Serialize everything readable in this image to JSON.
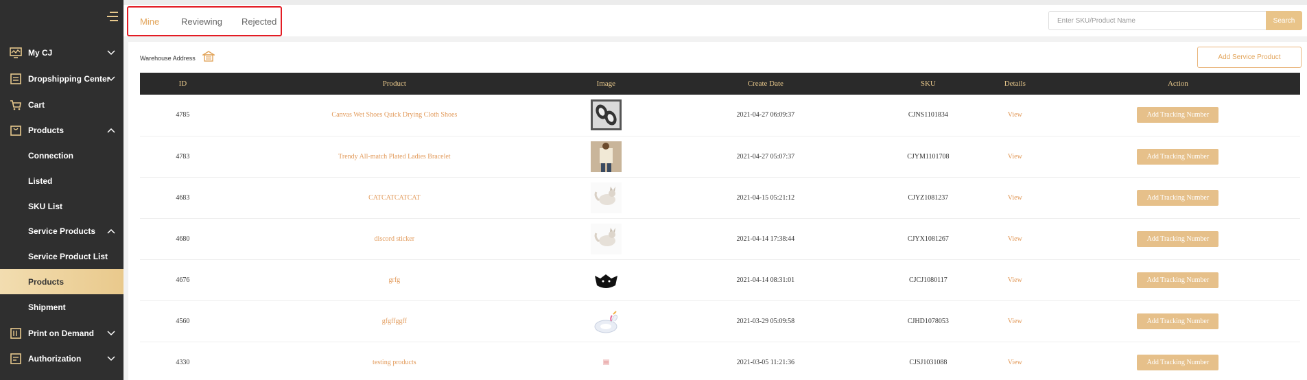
{
  "sidebar": {
    "items": [
      {
        "label": "My CJ",
        "icon": "monitor-icon",
        "chevron": "down"
      },
      {
        "label": "Dropshipping Center",
        "icon": "clipboard-icon",
        "chevron": "down"
      },
      {
        "label": "Cart",
        "icon": "cart-icon",
        "chevron": ""
      },
      {
        "label": "Products",
        "icon": "bag-icon",
        "chevron": "up"
      },
      {
        "label": "Connection"
      },
      {
        "label": "Listed"
      },
      {
        "label": "SKU List"
      },
      {
        "label": "Service Products",
        "chevron": "up"
      },
      {
        "label": "Service Product List"
      },
      {
        "label": "Products",
        "active": true
      },
      {
        "label": "Shipment"
      },
      {
        "label": "Print on Demand",
        "icon": "print-icon",
        "chevron": "down"
      },
      {
        "label": "Authorization",
        "icon": "authorization-icon",
        "chevron": "down"
      }
    ]
  },
  "tabs": [
    "Mine",
    "Reviewing",
    "Rejected"
  ],
  "search": {
    "placeholder": "Enter SKU/Product Name",
    "button": "Search"
  },
  "warehouse_label": "Warehouse Address",
  "add_service_label": "Add Service Product",
  "table": {
    "headers": [
      "ID",
      "Product",
      "Image",
      "Create Date",
      "SKU",
      "Details",
      "Action"
    ],
    "rows": [
      {
        "id": "4785",
        "product": "Canvas Wet Shoes Quick Drying Cloth Shoes",
        "image": "shoes",
        "date": "2021-04-27 06:09:37",
        "sku": "CJNS1101834",
        "details": "View",
        "action": "Add Tracking Number"
      },
      {
        "id": "4783",
        "product": "Trendy All-match Plated Ladies Bracelet",
        "image": "person",
        "date": "2021-04-27 05:07:37",
        "sku": "CJYM1101708",
        "details": "View",
        "action": "Add Tracking Number"
      },
      {
        "id": "4683",
        "product": "CATCATCATCAT",
        "image": "cat",
        "date": "2021-04-15 05:21:12",
        "sku": "CJYZ1081237",
        "details": "View",
        "action": "Add Tracking Number"
      },
      {
        "id": "4680",
        "product": "discord sticker",
        "image": "cat",
        "date": "2021-04-14 17:38:44",
        "sku": "CJYX1081267",
        "details": "View",
        "action": "Add Tracking Number"
      },
      {
        "id": "4676",
        "product": "grfg",
        "image": "bat",
        "date": "2021-04-14 08:31:01",
        "sku": "CJCJ1080117",
        "details": "View",
        "action": "Add Tracking Number"
      },
      {
        "id": "4560",
        "product": "gfgffggff",
        "image": "unicorn",
        "date": "2021-03-29 05:09:58",
        "sku": "CJHD1078053",
        "details": "View",
        "action": "Add Tracking Number"
      },
      {
        "id": "4330",
        "product": "testing products",
        "image": "small",
        "date": "2021-03-05 11:21:36",
        "sku": "CJSJ1031088",
        "details": "View",
        "action": "Add Tracking Number"
      }
    ]
  },
  "colors": {
    "accent": "#e2a45a",
    "sidebar_bg": "#2f2f2f",
    "button_bg": "#e6c08a",
    "header_bg": "#2a2a2a",
    "header_text": "#e9c98c"
  }
}
